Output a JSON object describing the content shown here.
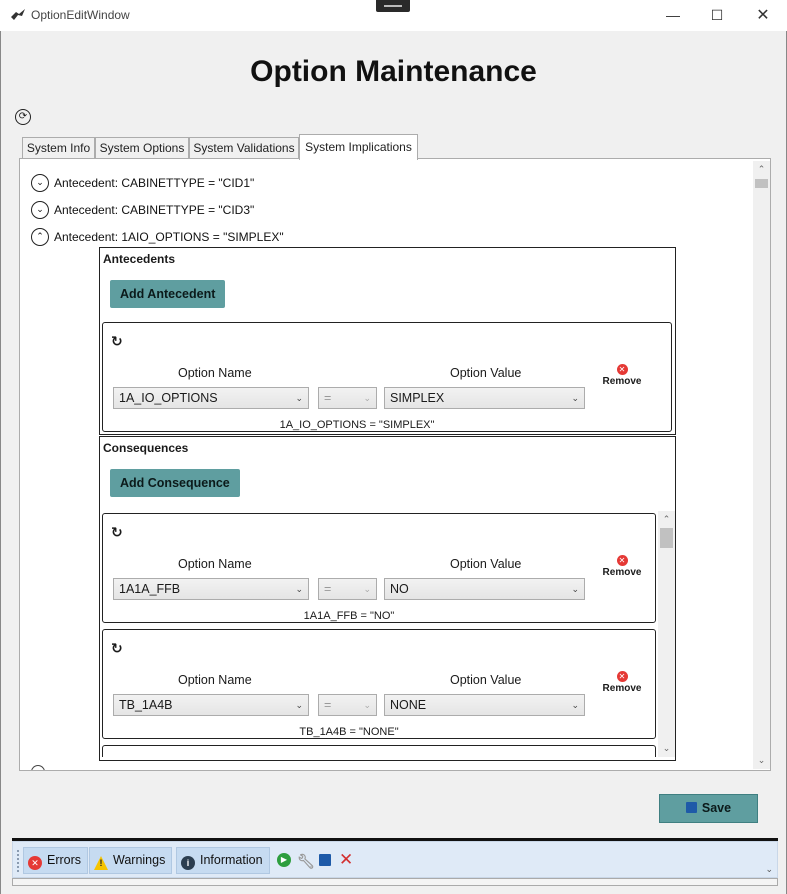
{
  "window": {
    "title": "OptionEditWindow",
    "controls": {
      "minimize": "—",
      "maximize": "☐",
      "close": "✕"
    }
  },
  "page_title": "Option Maintenance",
  "tabs": [
    {
      "label": "System Info"
    },
    {
      "label": "System Options"
    },
    {
      "label": "System Validations"
    },
    {
      "label": "System Implications",
      "active": true
    }
  ],
  "implications": [
    {
      "text": "Antecedent: CABINETTYPE = \"CID1\"",
      "expanded": false
    },
    {
      "text": "Antecedent: CABINETTYPE = \"CID3\"",
      "expanded": false
    },
    {
      "text": "Antecedent: 1AIO_OPTIONS = \"SIMPLEX\"",
      "expanded": true
    }
  ],
  "antecedents": {
    "title": "Antecedents",
    "add_label": "Add Antecedent",
    "items": [
      {
        "option_name_label": "Option Name",
        "option_value_label": "Option Value",
        "option": "1A_IO_OPTIONS",
        "operator": "=",
        "value": "SIMPLEX",
        "remove_label": "Remove",
        "expression": "1A_IO_OPTIONS = \"SIMPLEX\""
      }
    ]
  },
  "consequences": {
    "title": "Consequences",
    "add_label": "Add Consequence",
    "items": [
      {
        "option_name_label": "Option Name",
        "option_value_label": "Option Value",
        "option": "1A1A_FFB",
        "operator": "=",
        "value": "NO",
        "remove_label": "Remove",
        "expression": "1A1A_FFB = \"NO\""
      },
      {
        "option_name_label": "Option Name",
        "option_value_label": "Option Value",
        "option": "TB_1A4B",
        "operator": "=",
        "value": "NONE",
        "remove_label": "Remove",
        "expression": "TB_1A4B = \"NONE\""
      }
    ]
  },
  "save_label": "Save",
  "statusbar": {
    "errors_label": "Errors",
    "warnings_label": "Warnings",
    "information_label": "Information"
  },
  "colors": {
    "teal_button": "#5f9ea0",
    "status_bg": "#dfeaf7",
    "error_red": "#e53935",
    "warning_yellow": "#f5c400",
    "info_dark": "#2c3e50",
    "run_green": "#2e9e3e"
  }
}
